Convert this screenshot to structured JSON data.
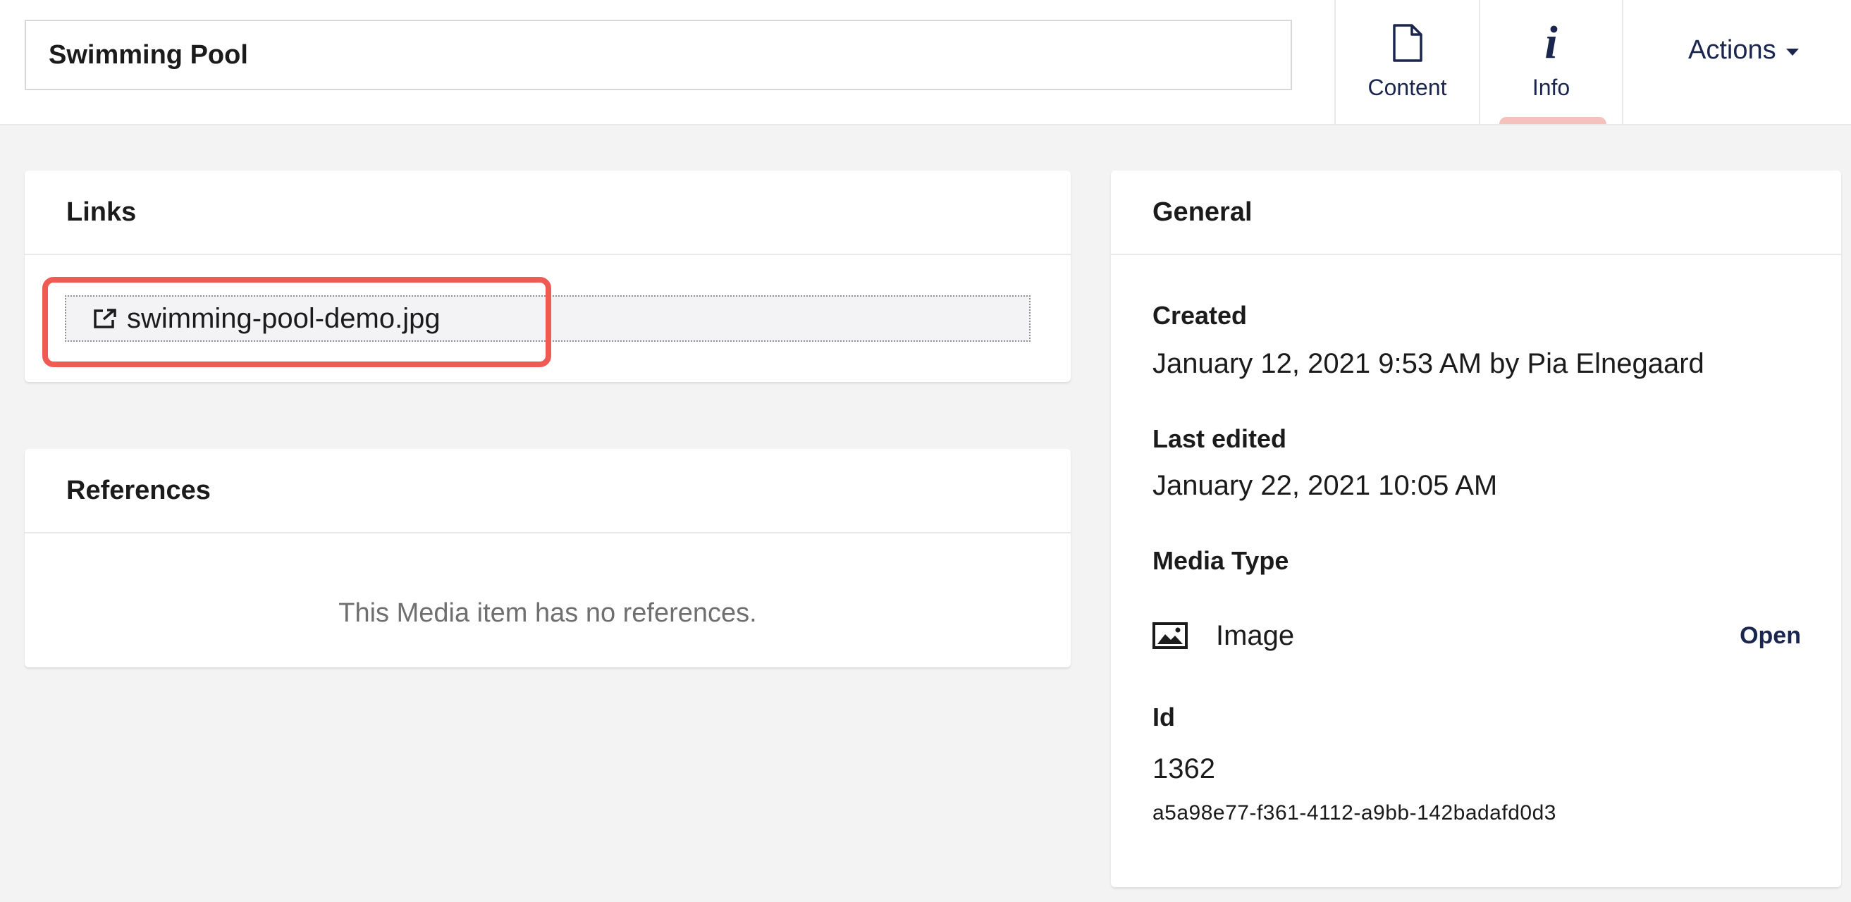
{
  "header": {
    "name_value": "Swimming Pool",
    "apps": [
      {
        "label": "Content",
        "icon": "document-icon",
        "active": false
      },
      {
        "label": "Info",
        "icon": "info-icon",
        "active": true
      }
    ],
    "actions_label": "Actions",
    "active_indicator_color": "#f5c1bc"
  },
  "links": {
    "title": "Links",
    "items": [
      {
        "label": "swimming-pool-demo.jpg",
        "icon": "external-link-icon"
      }
    ],
    "highlight_color": "#ef5b54"
  },
  "references": {
    "title": "References",
    "empty_message": "This Media item has no references."
  },
  "general": {
    "title": "General",
    "created_label": "Created",
    "created_value": "January 12, 2021 9:53 AM by Pia Elnegaard",
    "last_edited_label": "Last edited",
    "last_edited_value": "January 22, 2021 10:05 AM",
    "media_type_label": "Media Type",
    "media_type_value": "Image",
    "media_type_icon": "image-icon",
    "open_label": "Open",
    "id_label": "Id",
    "id_value": "1362",
    "key_value": "a5a98e77-f361-4112-a9bb-142badafd0d3"
  },
  "colors": {
    "accent": "#1b264f",
    "background": "#f4f3f3",
    "surface": "#ffffff"
  }
}
